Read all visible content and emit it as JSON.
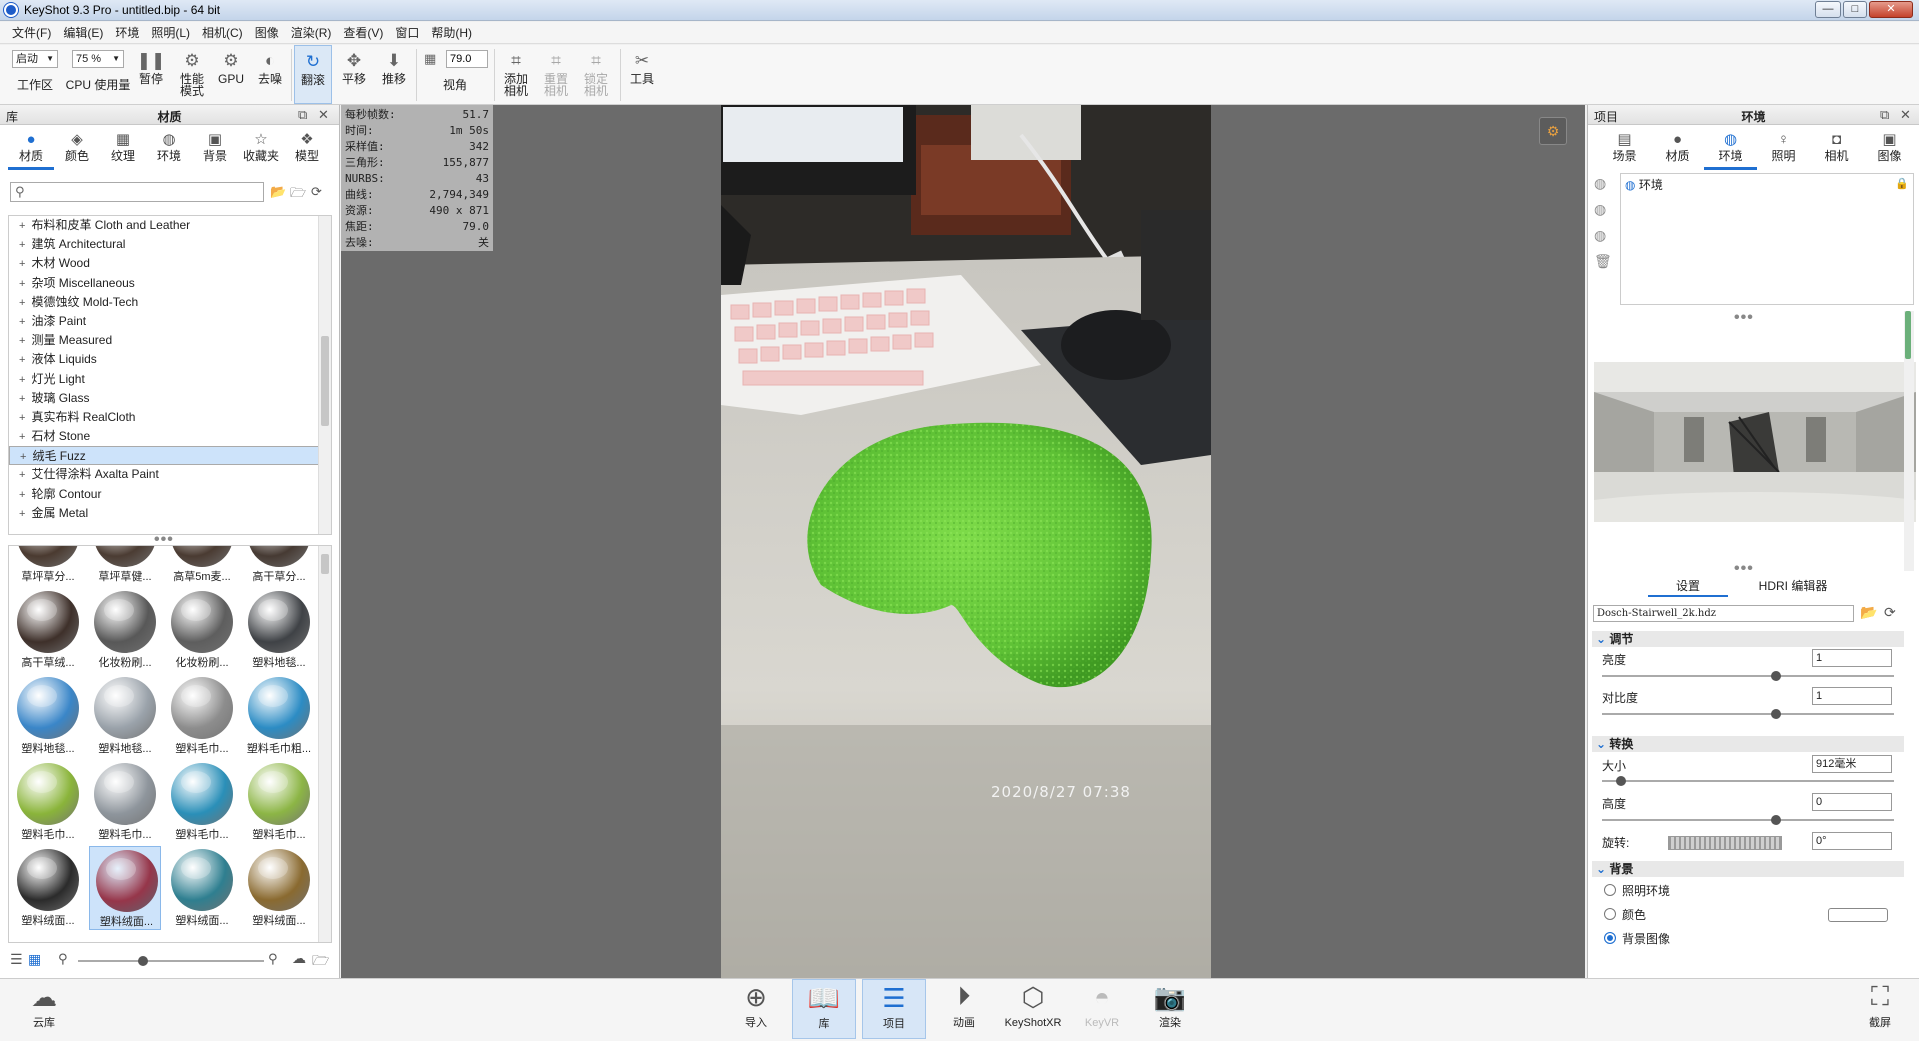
{
  "window": {
    "title": "KeyShot 9.3 Pro  - untitled.bip  - 64 bit",
    "controls": [
      "—",
      "□",
      "✕"
    ]
  },
  "menu": [
    "文件(F)",
    "编辑(E)",
    "环境",
    "照明(L)",
    "相机(C)",
    "图像",
    "渲染(R)",
    "查看(V)",
    "窗口",
    "帮助(H)"
  ],
  "toolbar": {
    "workspace_value": "启动",
    "workspace_label": "工作区",
    "cpu_value": "75 %",
    "cpu_label": "CPU 使用量",
    "pause": "暂停",
    "perf_mode": "性能\n模式",
    "gpu": "GPU",
    "denoise": "去噪",
    "tumble": "翻滚",
    "pan": "平移",
    "dolly": "推移",
    "fov_value": "79.0",
    "fov_label": "视角",
    "add_camera": "添加\n相机",
    "reset_camera": "重置\n相机",
    "lock_camera": "锁定\n相机",
    "tools": "工具"
  },
  "library": {
    "panel_title": "库",
    "center_title": "材质",
    "tabs": [
      "材质",
      "颜色",
      "纹理",
      "环境",
      "背景",
      "收藏夹",
      "模型"
    ],
    "active_tab": "材质",
    "tree": [
      "布料和皮革 Cloth and Leather",
      "建筑 Architectural",
      "木材 Wood",
      "杂项 Miscellaneous",
      "模德蚀纹 Mold-Tech",
      "油漆 Paint",
      "测量 Measured",
      "液体 Liquids",
      "灯光 Light",
      "玻璃 Glass",
      "真实布料 RealCloth",
      "石材 Stone",
      "绒毛 Fuzz",
      "艾仕得涂料 Axalta Paint",
      "轮廓 Contour",
      "金属 Metal"
    ],
    "selected_tree": "绒毛 Fuzz",
    "thumbs": [
      {
        "label": "草坪草分...",
        "color": "#4a3a30"
      },
      {
        "label": "草坪草健...",
        "color": "#4b3c33"
      },
      {
        "label": "高草5m麦...",
        "color": "#4a3b32"
      },
      {
        "label": "高干草分...",
        "color": "#463a33"
      },
      {
        "label": "高干草绒...",
        "color": "#3e302a"
      },
      {
        "label": "化妆粉刷...",
        "color": "#585858"
      },
      {
        "label": "化妆粉刷...",
        "color": "#5e5e5e"
      },
      {
        "label": "塑料地毯...",
        "color": "#3f4246"
      },
      {
        "label": "塑料地毯...",
        "color": "#3a86c8"
      },
      {
        "label": "塑料地毯...",
        "color": "#9aa2aa"
      },
      {
        "label": "塑料毛巾...",
        "color": "#8d8d8d"
      },
      {
        "label": "塑料毛巾粗...",
        "color": "#2c8cc4"
      },
      {
        "label": "塑料毛巾...",
        "color": "#8ab43a"
      },
      {
        "label": "塑料毛巾...",
        "color": "#8e959c"
      },
      {
        "label": "塑料毛巾...",
        "color": "#2a8fb8"
      },
      {
        "label": "塑料毛巾...",
        "color": "#8cb545"
      },
      {
        "label": "塑料绒面...",
        "color": "#2b2b2b"
      },
      {
        "label": "塑料绒面...",
        "color": "#96364a"
      },
      {
        "label": "塑料绒面...",
        "color": "#2f7f90"
      },
      {
        "label": "塑料绒面...",
        "color": "#8a6a30"
      }
    ],
    "selected_thumb_index": 17
  },
  "stats": [
    {
      "k": "每秒帧数:",
      "v": "51.7"
    },
    {
      "k": "时间:",
      "v": "1m 50s"
    },
    {
      "k": "采样值:",
      "v": "342"
    },
    {
      "k": "三角形:",
      "v": "155,877"
    },
    {
      "k": "NURBS:",
      "v": "43"
    },
    {
      "k": "曲线:",
      "v": "2,794,349"
    },
    {
      "k": "资源:",
      "v": "490 x 871"
    },
    {
      "k": "焦距:",
      "v": "79.0"
    },
    {
      "k": "去噪:",
      "v": "关"
    }
  ],
  "photo": {
    "timestamp": "2020/8/27  07:38"
  },
  "project": {
    "panel_title": "项目",
    "center_title": "环境",
    "tabs": [
      "场景",
      "材质",
      "环境",
      "照明",
      "相机",
      "图像"
    ],
    "active_tab": "环境",
    "tree_item": "环境",
    "subtabs": [
      "设置",
      "HDRI 编辑器"
    ],
    "hdr_file": "Dosch-Stairwell_2k.hdz",
    "adjust": {
      "title": "调节",
      "brightness_label": "亮度",
      "brightness": "1",
      "brightness_pos": 0.6,
      "contrast_label": "对比度",
      "contrast": "1",
      "contrast_pos": 0.6
    },
    "transform": {
      "title": "转换",
      "size_label": "大小",
      "size": "912毫米",
      "size_pos": 0.05,
      "height_label": "高度",
      "height": "0",
      "height_pos": 0.6,
      "rotation_label": "旋转:",
      "rotation": "0°"
    },
    "background": {
      "title": "背景",
      "options": [
        "照明环境",
        "颜色",
        "背景图像"
      ],
      "selected": "背景图像"
    }
  },
  "bottombar": {
    "cloud": "云库",
    "items": [
      "导入",
      "库",
      "项目",
      "动画",
      "KeyShotXR",
      "KeyVR",
      "渲染"
    ],
    "active": [
      "库",
      "项目"
    ],
    "disabled": [
      "KeyVR"
    ],
    "screenshot": "截屏"
  }
}
